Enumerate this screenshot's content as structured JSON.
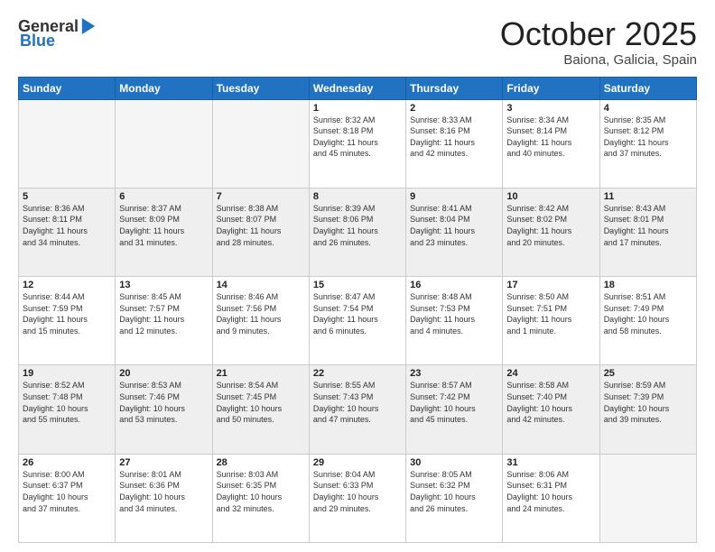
{
  "header": {
    "logo_general": "General",
    "logo_blue": "Blue",
    "title": "October 2025",
    "subtitle": "Baiona, Galicia, Spain"
  },
  "days_of_week": [
    "Sunday",
    "Monday",
    "Tuesday",
    "Wednesday",
    "Thursday",
    "Friday",
    "Saturday"
  ],
  "weeks": [
    [
      {
        "day": "",
        "info": ""
      },
      {
        "day": "",
        "info": ""
      },
      {
        "day": "",
        "info": ""
      },
      {
        "day": "1",
        "info": "Sunrise: 8:32 AM\nSunset: 8:18 PM\nDaylight: 11 hours\nand 45 minutes."
      },
      {
        "day": "2",
        "info": "Sunrise: 8:33 AM\nSunset: 8:16 PM\nDaylight: 11 hours\nand 42 minutes."
      },
      {
        "day": "3",
        "info": "Sunrise: 8:34 AM\nSunset: 8:14 PM\nDaylight: 11 hours\nand 40 minutes."
      },
      {
        "day": "4",
        "info": "Sunrise: 8:35 AM\nSunset: 8:12 PM\nDaylight: 11 hours\nand 37 minutes."
      }
    ],
    [
      {
        "day": "5",
        "info": "Sunrise: 8:36 AM\nSunset: 8:11 PM\nDaylight: 11 hours\nand 34 minutes."
      },
      {
        "day": "6",
        "info": "Sunrise: 8:37 AM\nSunset: 8:09 PM\nDaylight: 11 hours\nand 31 minutes."
      },
      {
        "day": "7",
        "info": "Sunrise: 8:38 AM\nSunset: 8:07 PM\nDaylight: 11 hours\nand 28 minutes."
      },
      {
        "day": "8",
        "info": "Sunrise: 8:39 AM\nSunset: 8:06 PM\nDaylight: 11 hours\nand 26 minutes."
      },
      {
        "day": "9",
        "info": "Sunrise: 8:41 AM\nSunset: 8:04 PM\nDaylight: 11 hours\nand 23 minutes."
      },
      {
        "day": "10",
        "info": "Sunrise: 8:42 AM\nSunset: 8:02 PM\nDaylight: 11 hours\nand 20 minutes."
      },
      {
        "day": "11",
        "info": "Sunrise: 8:43 AM\nSunset: 8:01 PM\nDaylight: 11 hours\nand 17 minutes."
      }
    ],
    [
      {
        "day": "12",
        "info": "Sunrise: 8:44 AM\nSunset: 7:59 PM\nDaylight: 11 hours\nand 15 minutes."
      },
      {
        "day": "13",
        "info": "Sunrise: 8:45 AM\nSunset: 7:57 PM\nDaylight: 11 hours\nand 12 minutes."
      },
      {
        "day": "14",
        "info": "Sunrise: 8:46 AM\nSunset: 7:56 PM\nDaylight: 11 hours\nand 9 minutes."
      },
      {
        "day": "15",
        "info": "Sunrise: 8:47 AM\nSunset: 7:54 PM\nDaylight: 11 hours\nand 6 minutes."
      },
      {
        "day": "16",
        "info": "Sunrise: 8:48 AM\nSunset: 7:53 PM\nDaylight: 11 hours\nand 4 minutes."
      },
      {
        "day": "17",
        "info": "Sunrise: 8:50 AM\nSunset: 7:51 PM\nDaylight: 11 hours\nand 1 minute."
      },
      {
        "day": "18",
        "info": "Sunrise: 8:51 AM\nSunset: 7:49 PM\nDaylight: 10 hours\nand 58 minutes."
      }
    ],
    [
      {
        "day": "19",
        "info": "Sunrise: 8:52 AM\nSunset: 7:48 PM\nDaylight: 10 hours\nand 55 minutes."
      },
      {
        "day": "20",
        "info": "Sunrise: 8:53 AM\nSunset: 7:46 PM\nDaylight: 10 hours\nand 53 minutes."
      },
      {
        "day": "21",
        "info": "Sunrise: 8:54 AM\nSunset: 7:45 PM\nDaylight: 10 hours\nand 50 minutes."
      },
      {
        "day": "22",
        "info": "Sunrise: 8:55 AM\nSunset: 7:43 PM\nDaylight: 10 hours\nand 47 minutes."
      },
      {
        "day": "23",
        "info": "Sunrise: 8:57 AM\nSunset: 7:42 PM\nDaylight: 10 hours\nand 45 minutes."
      },
      {
        "day": "24",
        "info": "Sunrise: 8:58 AM\nSunset: 7:40 PM\nDaylight: 10 hours\nand 42 minutes."
      },
      {
        "day": "25",
        "info": "Sunrise: 8:59 AM\nSunset: 7:39 PM\nDaylight: 10 hours\nand 39 minutes."
      }
    ],
    [
      {
        "day": "26",
        "info": "Sunrise: 8:00 AM\nSunset: 6:37 PM\nDaylight: 10 hours\nand 37 minutes."
      },
      {
        "day": "27",
        "info": "Sunrise: 8:01 AM\nSunset: 6:36 PM\nDaylight: 10 hours\nand 34 minutes."
      },
      {
        "day": "28",
        "info": "Sunrise: 8:03 AM\nSunset: 6:35 PM\nDaylight: 10 hours\nand 32 minutes."
      },
      {
        "day": "29",
        "info": "Sunrise: 8:04 AM\nSunset: 6:33 PM\nDaylight: 10 hours\nand 29 minutes."
      },
      {
        "day": "30",
        "info": "Sunrise: 8:05 AM\nSunset: 6:32 PM\nDaylight: 10 hours\nand 26 minutes."
      },
      {
        "day": "31",
        "info": "Sunrise: 8:06 AM\nSunset: 6:31 PM\nDaylight: 10 hours\nand 24 minutes."
      },
      {
        "day": "",
        "info": ""
      }
    ]
  ]
}
